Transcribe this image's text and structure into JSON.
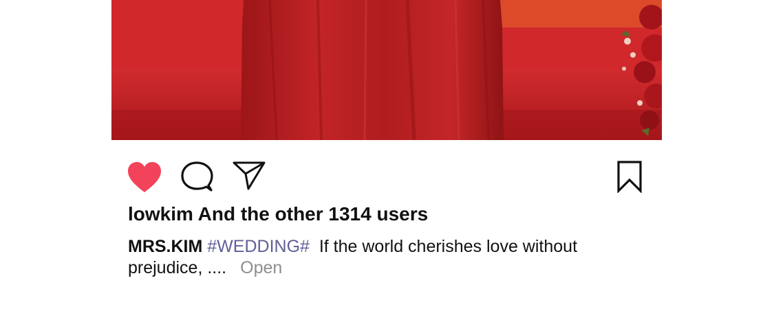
{
  "post": {
    "image": {
      "alt_semantic": "red-wedding-dress-photo"
    },
    "actions": {
      "like_icon": "heart-icon",
      "like_color": "#f2435a",
      "comment_icon": "comment-icon",
      "share_icon": "send-icon",
      "save_icon": "bookmark-icon"
    },
    "likes_text": "lowkim And the other 1314 users",
    "caption": {
      "username": "MRS.KIM",
      "hashtag": "#WEDDING#",
      "text_line1": "If the world cherishes love without",
      "text_line2": "prejudice, ....",
      "more_label": "Open"
    },
    "colors": {
      "hashtag": "#5f5f99",
      "more": "#8e8e8e",
      "photo_red": "#c8262a"
    }
  }
}
